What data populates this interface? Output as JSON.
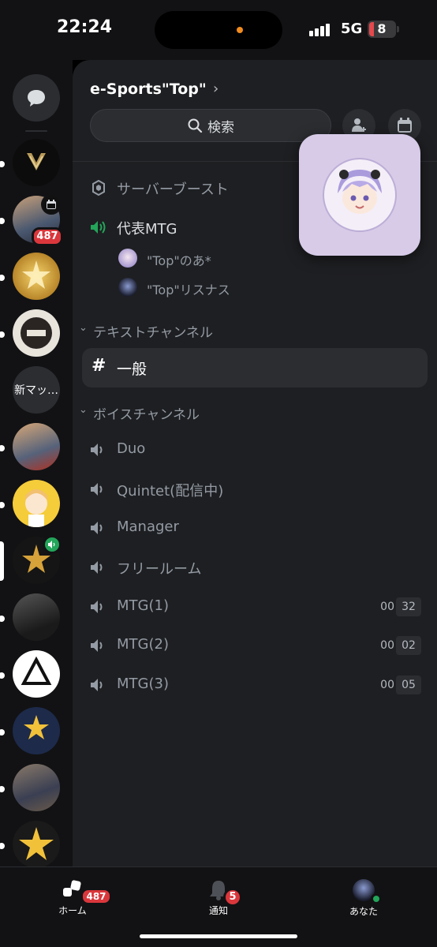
{
  "status_bar": {
    "time": "22:24",
    "network": "5G",
    "battery": "8"
  },
  "rail": {
    "folder_label": "新マッ…",
    "badge_487": "487"
  },
  "server": {
    "name": "e-Sports\"Top\"",
    "search_placeholder": "検索"
  },
  "channels": {
    "boost": "サーバーブースト",
    "voice_active": "代表MTG",
    "members": [
      "\"Top\"のあ*",
      "\"Top\"リスナス"
    ],
    "text_category": "テキストチャンネル",
    "selected_channel": "一般",
    "voice_category": "ボイスチャンネル",
    "voice_channels": [
      {
        "name": "Duo"
      },
      {
        "name": "Quintet(配信中)"
      },
      {
        "name": "Manager"
      },
      {
        "name": "フリールーム"
      },
      {
        "name": "MTG(1)",
        "count_a": "00",
        "count_b": "32"
      },
      {
        "name": "MTG(2)",
        "count_a": "00",
        "count_b": "02"
      },
      {
        "name": "MTG(3)",
        "count_a": "00",
        "count_b": "05"
      }
    ]
  },
  "tabbar": {
    "home_label": "ホーム",
    "home_badge": "487",
    "notif_label": "通知",
    "notif_badge": "5",
    "you_label": "あなた"
  },
  "colors": {
    "accent_green": "#23a55a",
    "badge_red": "#da373c",
    "panel_bg": "#1e1f22",
    "rail_bg": "#121214"
  }
}
